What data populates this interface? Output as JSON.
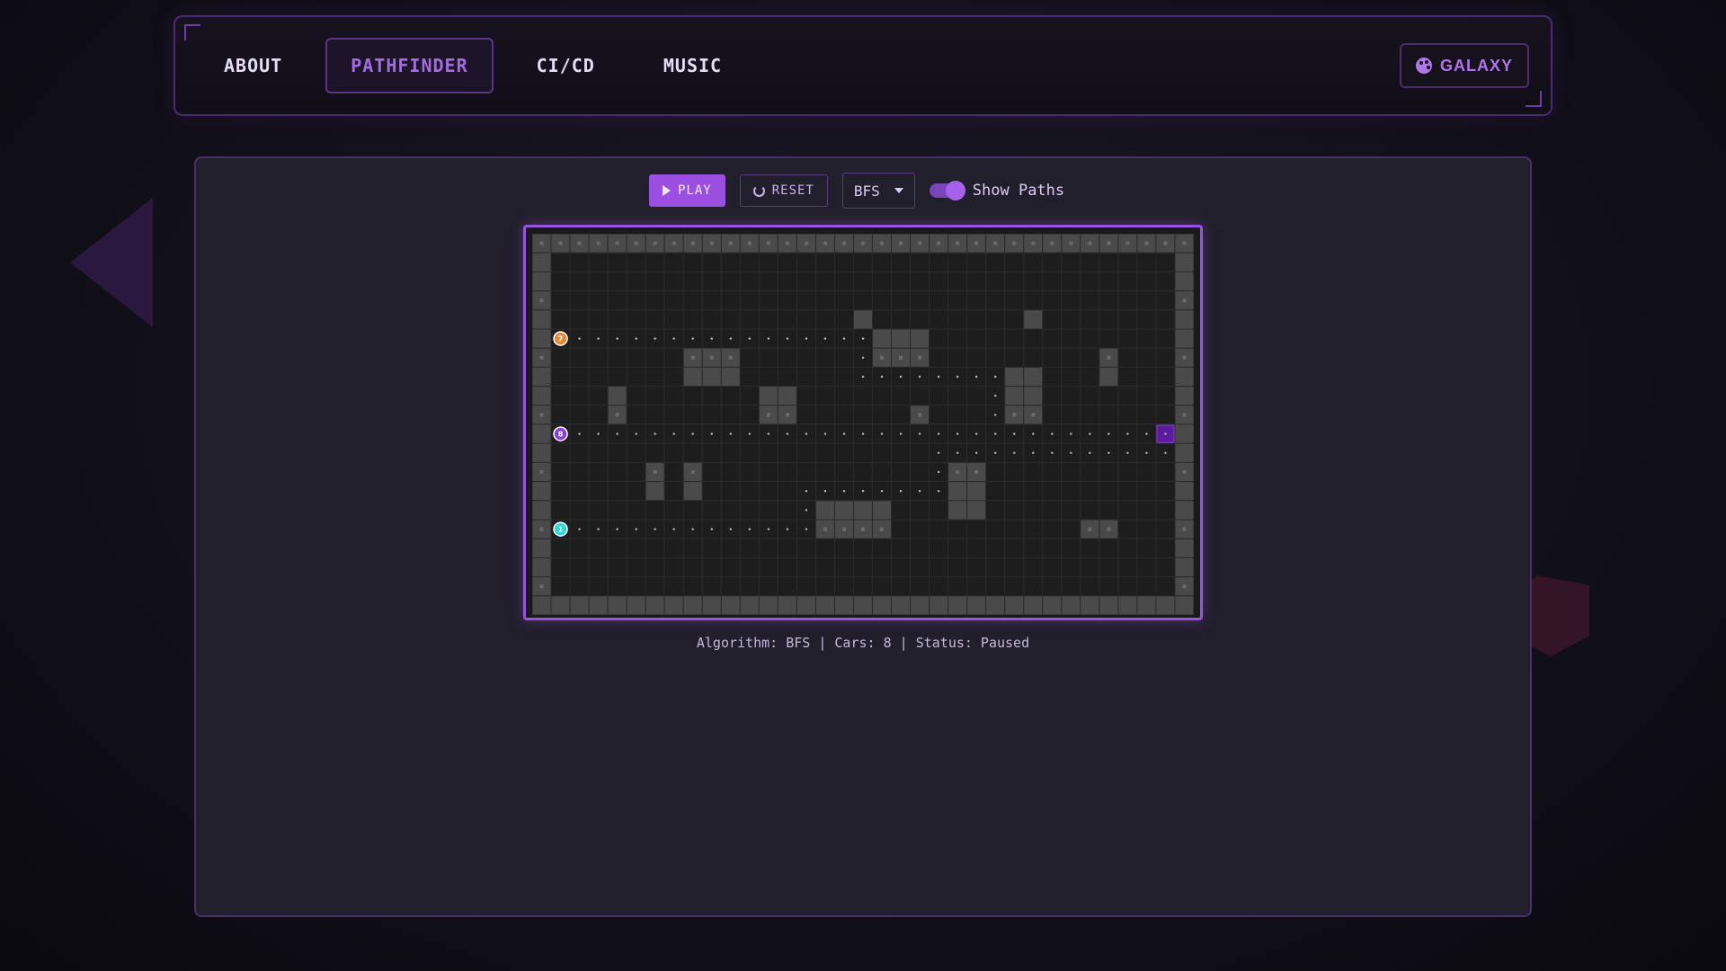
{
  "nav": {
    "tabs": [
      {
        "label": "ABOUT",
        "active": false
      },
      {
        "label": "PATHFINDER",
        "active": true
      },
      {
        "label": "CI/CD",
        "active": false
      },
      {
        "label": "MUSIC",
        "active": false
      }
    ],
    "theme_button": {
      "label": "GALAXY",
      "icon": "palette-icon"
    }
  },
  "controls": {
    "play_label": "PLAY",
    "reset_label": "RESET",
    "algorithm": "BFS",
    "show_paths_label": "Show Paths",
    "show_paths": true
  },
  "grid": {
    "cols": 35,
    "rows": 20,
    "obstacles": [
      [
        17,
        4
      ],
      [
        26,
        4
      ],
      [
        18,
        5
      ],
      [
        19,
        5
      ],
      [
        20,
        5
      ],
      [
        8,
        6
      ],
      [
        9,
        6
      ],
      [
        10,
        6
      ],
      [
        18,
        6
      ],
      [
        19,
        6
      ],
      [
        20,
        6
      ],
      [
        30,
        6
      ],
      [
        8,
        7
      ],
      [
        9,
        7
      ],
      [
        10,
        7
      ],
      [
        25,
        7
      ],
      [
        26,
        7
      ],
      [
        30,
        7
      ],
      [
        4,
        8
      ],
      [
        12,
        8
      ],
      [
        13,
        8
      ],
      [
        25,
        8
      ],
      [
        26,
        8
      ],
      [
        4,
        9
      ],
      [
        12,
        9
      ],
      [
        13,
        9
      ],
      [
        20,
        9
      ],
      [
        25,
        9
      ],
      [
        26,
        9
      ],
      [
        6,
        12
      ],
      [
        8,
        12
      ],
      [
        22,
        12
      ],
      [
        23,
        12
      ],
      [
        6,
        13
      ],
      [
        8,
        13
      ],
      [
        22,
        13
      ],
      [
        23,
        13
      ],
      [
        15,
        14
      ],
      [
        16,
        14
      ],
      [
        17,
        14
      ],
      [
        18,
        14
      ],
      [
        22,
        14
      ],
      [
        23,
        14
      ],
      [
        15,
        15
      ],
      [
        16,
        15
      ],
      [
        17,
        15
      ],
      [
        18,
        15
      ],
      [
        29,
        15
      ],
      [
        30,
        15
      ]
    ],
    "paths": [
      {
        "row": 5,
        "from": 2,
        "to": 17
      },
      {
        "row": 6,
        "from": 17,
        "to": 17
      },
      {
        "row": 7,
        "from": 17,
        "to": 24
      },
      {
        "row": 8,
        "from": 24,
        "to": 24
      },
      {
        "row": 9,
        "from": 24,
        "to": 24
      },
      {
        "row": 10,
        "from": 2,
        "to": 33
      },
      {
        "row": 11,
        "from": 21,
        "to": 33
      },
      {
        "row": 12,
        "from": 21,
        "to": 21
      },
      {
        "row": 13,
        "from": 14,
        "to": 21
      },
      {
        "row": 14,
        "from": 14,
        "to": 14
      },
      {
        "row": 15,
        "from": 2,
        "to": 14
      }
    ],
    "cars": [
      {
        "row": 5,
        "col": 1,
        "color": "#e8883a",
        "label": "7"
      },
      {
        "row": 10,
        "col": 1,
        "color": "#8a3fd6",
        "label": "8"
      },
      {
        "row": 15,
        "col": 1,
        "color": "#2ed6d6",
        "label": "1"
      }
    ],
    "goal": {
      "row": 10,
      "col": 33
    },
    "colors": {
      "wall": "#4a4a4a",
      "empty": "#1d1d1d",
      "line": "#2b2b2b",
      "path_dot": "#bdbdbd",
      "goal": "#5d1c9e"
    }
  },
  "status": {
    "text": "Algorithm: BFS | Cars: 8 | Status: Paused"
  }
}
